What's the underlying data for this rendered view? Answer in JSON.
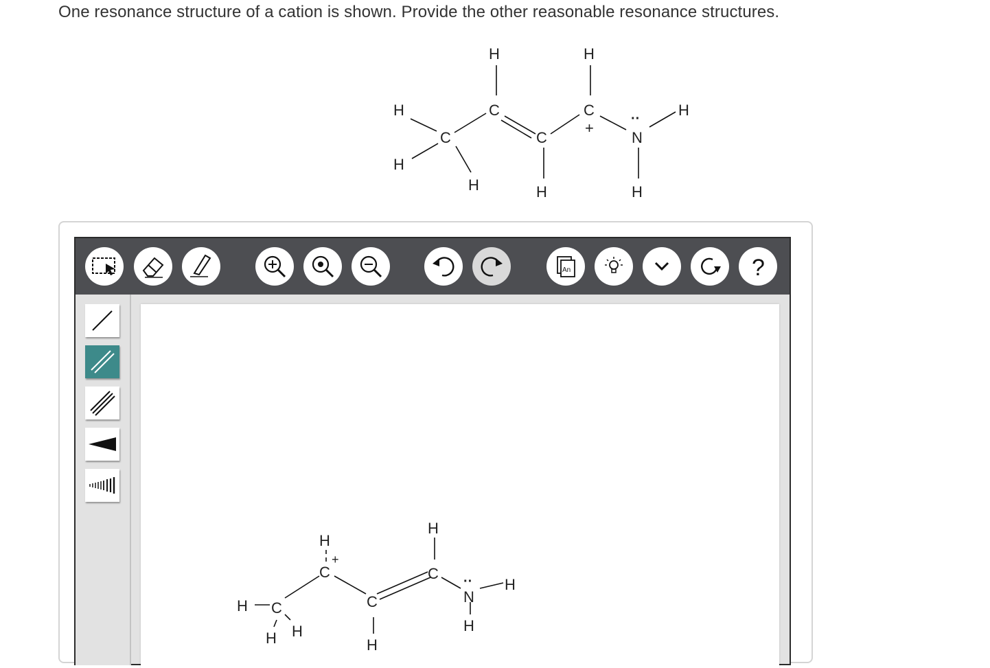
{
  "question": {
    "text": "One resonance structure of a cation is shown. Provide the other reasonable resonance structures."
  },
  "given_structure": {
    "atom_labels": {
      "h_top1": "H",
      "h_top2": "H",
      "h_left1": "H",
      "h_left2": "H",
      "h_right": "H",
      "h_bottom1": "H",
      "h_bottom2": "H",
      "h_bottom3": "H",
      "c1": "C",
      "c2": "C",
      "c3": "C",
      "c4": "C",
      "n": "N",
      "charge": "+",
      "lone_pair": ":"
    }
  },
  "toolbar": {
    "buttons": [
      {
        "name": "select",
        "label": "select tool"
      },
      {
        "name": "eraser",
        "label": "erase tool"
      },
      {
        "name": "pencil",
        "label": "draw tool"
      },
      {
        "name": "zoom-in",
        "label": "zoom in"
      },
      {
        "name": "zoom-reset",
        "label": "reset zoom"
      },
      {
        "name": "zoom-out",
        "label": "zoom out"
      },
      {
        "name": "undo",
        "label": "undo"
      },
      {
        "name": "redo",
        "label": "redo"
      },
      {
        "name": "templates",
        "label": "An"
      },
      {
        "name": "hint",
        "label": "hint"
      },
      {
        "name": "more",
        "label": "more"
      },
      {
        "name": "refresh",
        "label": "clear"
      },
      {
        "name": "help",
        "label": "?"
      }
    ]
  },
  "bond_tools": [
    {
      "name": "single-bond",
      "active": false
    },
    {
      "name": "double-bond",
      "active": true
    },
    {
      "name": "triple-bond",
      "active": false
    },
    {
      "name": "wedge-bond",
      "active": false
    },
    {
      "name": "hash-bond",
      "active": false
    }
  ],
  "canvas_structure": {
    "atom_labels": {
      "h1": "H",
      "h2": "H",
      "h3": "H",
      "h4": "H",
      "h5": "H",
      "h6": "H",
      "h7": "H",
      "h8": "H",
      "c1": "C",
      "c2": "C",
      "c3": "C",
      "c4": "C",
      "n": "N",
      "charge": "+"
    }
  },
  "colors": {
    "toolbar_bg": "#4d4e52",
    "active_tool": "#3d8a8a",
    "panel_bg": "#e2e2e2"
  }
}
